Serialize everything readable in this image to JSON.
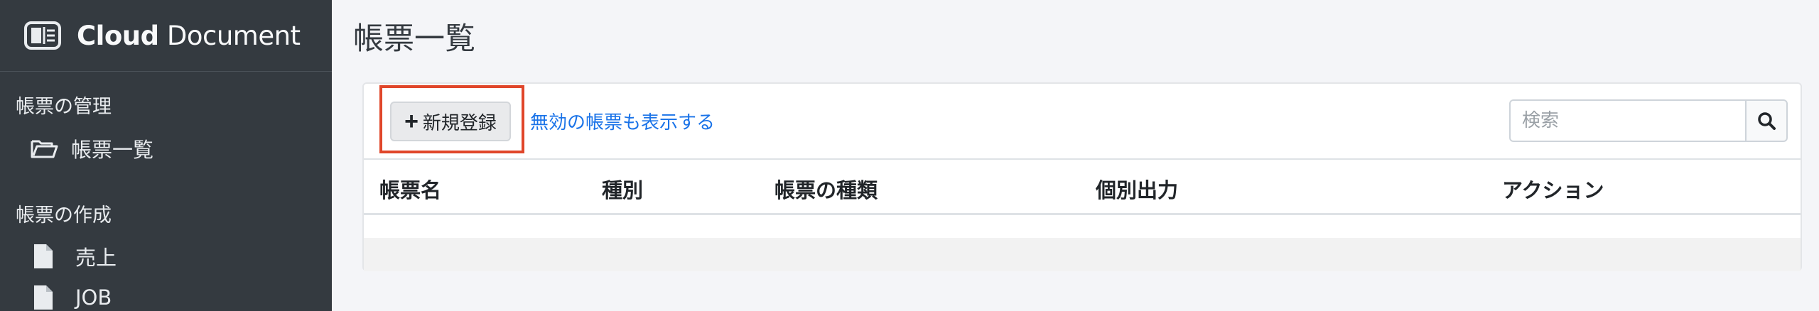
{
  "app": {
    "brand_strong": "Cloud",
    "brand_rest": " Document"
  },
  "sidebar": {
    "sections": [
      {
        "title": "帳票の管理",
        "items": [
          {
            "label": "帳票一覧",
            "icon": "folder-open-icon"
          }
        ]
      },
      {
        "title": "帳票の作成",
        "items": [
          {
            "label": "売上",
            "icon": "file-icon"
          },
          {
            "label": "JOB",
            "icon": "file-icon"
          }
        ]
      }
    ]
  },
  "main": {
    "page_title": "帳票一覧",
    "toolbar": {
      "new_button_label": "新規登録",
      "new_button_icon": "plus-icon",
      "show_invalid_link": "無効の帳票も表示する",
      "search_placeholder": "検索",
      "search_button_icon": "search-icon"
    },
    "table": {
      "columns": [
        "帳票名",
        "種別",
        "帳票の種類",
        "個別出力",
        "アクション"
      ],
      "rows": []
    }
  },
  "colors": {
    "sidebar_bg": "#343a40",
    "link": "#1a73e8",
    "highlight": "#e0462a"
  }
}
